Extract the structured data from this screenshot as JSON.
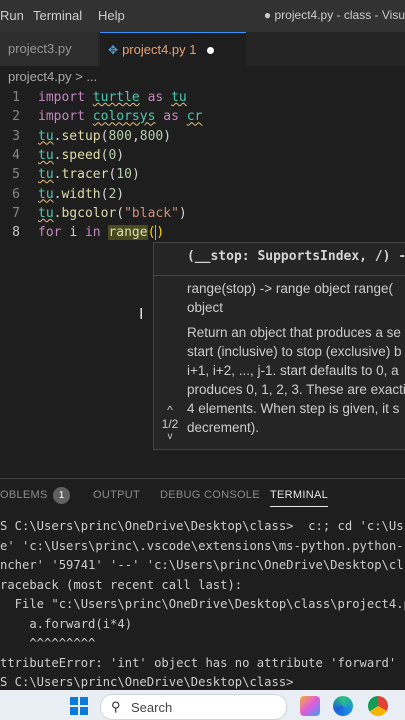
{
  "menubar": {
    "items": [
      "Run",
      "Terminal",
      "Help"
    ],
    "title": "● project4.py - class - Visu"
  },
  "tabs": [
    {
      "label": "project3.py"
    },
    {
      "label": "project4.py 1",
      "icon": "python-icon"
    }
  ],
  "breadcrumb": "project4.py > ...",
  "editor": {
    "line_numbers": [
      "1",
      "2",
      "3",
      "4",
      "5",
      "6",
      "7",
      "8"
    ],
    "lines": [
      [
        [
          "kw",
          "import "
        ],
        [
          "mod",
          "turtle"
        ],
        [
          "kw",
          " as "
        ],
        [
          "mod",
          "tu"
        ]
      ],
      [
        [
          "kw",
          "import "
        ],
        [
          "mod",
          "colorsys"
        ],
        [
          "kw",
          " as "
        ],
        [
          "mod",
          "cr"
        ]
      ],
      [
        [
          "mod",
          "tu"
        ],
        [
          "plain",
          "."
        ],
        [
          "fn",
          "setup"
        ],
        [
          "plain",
          "("
        ],
        [
          "num",
          "800"
        ],
        [
          "plain",
          ","
        ],
        [
          "num",
          "800"
        ],
        [
          "plain",
          ")"
        ]
      ],
      [
        [
          "mod",
          "tu"
        ],
        [
          "plain",
          "."
        ],
        [
          "fn",
          "speed"
        ],
        [
          "plain",
          "("
        ],
        [
          "num",
          "0"
        ],
        [
          "plain",
          ")"
        ]
      ],
      [
        [
          "mod",
          "tu"
        ],
        [
          "plain",
          "."
        ],
        [
          "fn",
          "tracer"
        ],
        [
          "plain",
          "("
        ],
        [
          "num",
          "10"
        ],
        [
          "plain",
          ")"
        ]
      ],
      [
        [
          "mod",
          "tu"
        ],
        [
          "plain",
          "."
        ],
        [
          "fn",
          "width"
        ],
        [
          "plain",
          "("
        ],
        [
          "num",
          "2"
        ],
        [
          "plain",
          ")"
        ]
      ],
      [
        [
          "mod",
          "tu"
        ],
        [
          "plain",
          "."
        ],
        [
          "fn",
          "bgcolor"
        ],
        [
          "plain",
          "("
        ],
        [
          "str",
          "\"black\""
        ],
        [
          "plain",
          ")"
        ]
      ],
      [
        [
          "kw",
          "for "
        ],
        [
          "plain",
          "i "
        ],
        [
          "kw",
          "in "
        ],
        [
          "fnhl",
          "range"
        ],
        [
          "paren",
          "("
        ],
        [
          "caret",
          ""
        ],
        [
          "paren",
          ")"
        ]
      ]
    ]
  },
  "hover": {
    "signature": "(__stop: SupportsIndex, /) -",
    "summary": "range(stop) -> range object range(",
    "summary2": "object",
    "doc": "Return an object that produces a se start (inclusive) to stop (exclusive) b i+1, i+2, ..., j-1. start defaults to 0, a produces 0, 1, 2, 3. These are exacti 4 elements. When step is given, it s decrement).",
    "nav_up": "^",
    "nav_count": "1/2",
    "nav_down": "v"
  },
  "panel": {
    "tabs": [
      "OBLEMS",
      "OUTPUT",
      "DEBUG CONSOLE",
      "TERMINAL"
    ],
    "problems_count": "1",
    "terminal_lines": [
      "S C:\\Users\\princ\\OneDrive\\Desktop\\class>  c:; cd 'c:\\Us",
      "e' 'c:\\Users\\princ\\.vscode\\extensions\\ms-python.python-",
      "ncher' '59741' '--' 'c:\\Users\\princ\\OneDrive\\Desktop\\cl",
      "raceback (most recent call last):",
      "  File \"c:\\Users\\princ\\OneDrive\\Desktop\\class\\project4.p",
      "    a.forward(i*4)",
      "    ^^^^^^^^^",
      "ttributeError: 'int' object has no attribute 'forward'",
      "S C:\\Users\\princ\\OneDrive\\Desktop\\class>"
    ]
  },
  "taskbar": {
    "search_label": "Search",
    "icons": [
      "windows-logo-icon",
      "search-icon",
      "copilot-icon",
      "edge-icon",
      "chrome-icon"
    ]
  },
  "colors": {
    "editor_bg": "#1e1e1e",
    "keyword": "#c586c0",
    "module": "#4ec9b0",
    "function": "#dcdcaa",
    "number": "#b5cea8",
    "string": "#ce9178",
    "active_tab_text": "#e8a275",
    "taskbar_bg": "#e9eef4"
  }
}
